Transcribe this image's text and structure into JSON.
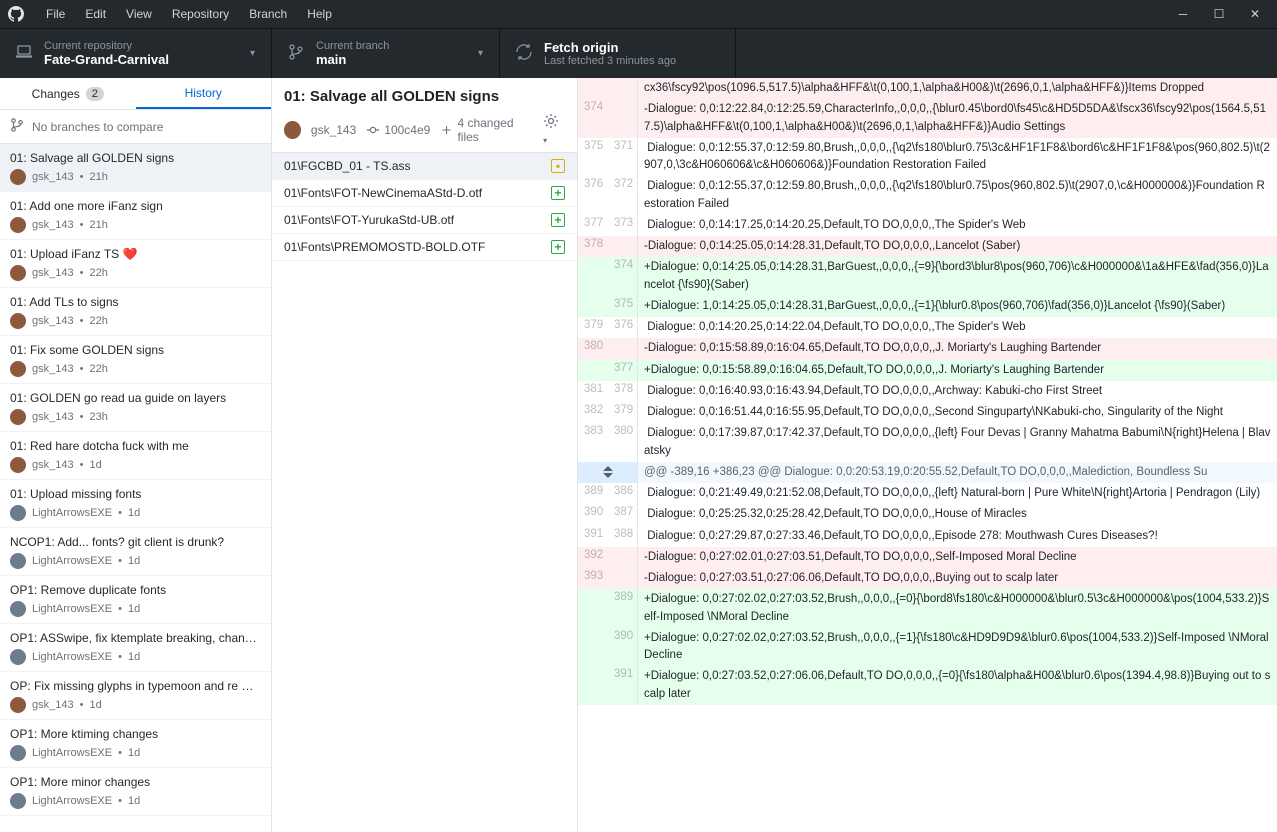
{
  "menus": [
    "File",
    "Edit",
    "View",
    "Repository",
    "Branch",
    "Help"
  ],
  "repo": {
    "label": "Current repository",
    "value": "Fate-Grand-Carnival"
  },
  "branch": {
    "label": "Current branch",
    "value": "main"
  },
  "fetch": {
    "label": "Fetch origin",
    "value": "Last fetched 3 minutes ago"
  },
  "tabs": {
    "changes": "Changes",
    "changes_count": "2",
    "history": "History"
  },
  "compare_text": "No branches to compare",
  "commits": [
    {
      "title": "01: Salvage all GOLDEN signs",
      "author": "gsk_143",
      "time": "21h",
      "avatar": "a",
      "selected": true
    },
    {
      "title": "01: Add one more iFanz sign",
      "author": "gsk_143",
      "time": "21h",
      "avatar": "a"
    },
    {
      "title": "01: Upload iFanz TS ❤️",
      "author": "gsk_143",
      "time": "22h",
      "avatar": "a"
    },
    {
      "title": "01: Add TLs to signs",
      "author": "gsk_143",
      "time": "22h",
      "avatar": "a"
    },
    {
      "title": "01: Fix some GOLDEN signs",
      "author": "gsk_143",
      "time": "22h",
      "avatar": "a"
    },
    {
      "title": "01: GOLDEN go read ua guide on layers",
      "author": "gsk_143",
      "time": "23h",
      "avatar": "a"
    },
    {
      "title": "01: Red hare dotcha fuck with me",
      "author": "gsk_143",
      "time": "1d",
      "avatar": "a"
    },
    {
      "title": "01: Upload missing fonts",
      "author": "LightArrowsEXE",
      "time": "1d",
      "avatar": "b"
    },
    {
      "title": "NCOP1: Add... fonts? git client is drunk?",
      "author": "LightArrowsEXE",
      "time": "1d",
      "avatar": "b"
    },
    {
      "title": "OP1: Remove duplicate fonts",
      "author": "LightArrowsEXE",
      "time": "1d",
      "avatar": "b"
    },
    {
      "title": "OP1: ASSwipe, fix ktemplate breaking, chan…",
      "author": "LightArrowsEXE",
      "time": "1d",
      "avatar": "b"
    },
    {
      "title": "OP: Fix missing glyphs in typemoon and re …",
      "author": "gsk_143",
      "time": "1d",
      "avatar": "a"
    },
    {
      "title": "OP1: More ktiming changes",
      "author": "LightArrowsEXE",
      "time": "1d",
      "avatar": "b"
    },
    {
      "title": "OP1: More minor changes",
      "author": "LightArrowsEXE",
      "time": "1d",
      "avatar": "b"
    }
  ],
  "commit_detail": {
    "title": "01: Salvage all GOLDEN signs",
    "author": "gsk_143",
    "sha": "100c4e9",
    "files_changed": "4 changed files"
  },
  "files": [
    {
      "name": "01\\FGCBD_01 - TS.ass",
      "status": "modified",
      "selected": true
    },
    {
      "name": "01\\Fonts\\FOT-NewCinemaAStd-D.otf",
      "status": "added"
    },
    {
      "name": "01\\Fonts\\FOT-YurukaStd-UB.otf",
      "status": "added"
    },
    {
      "name": "01\\Fonts\\PREMOMOSTD-BOLD.OTF",
      "status": "added"
    }
  ],
  "diff": [
    {
      "type": "del",
      "old": "",
      "new": "",
      "code": "cx36\\fscy92\\pos(1096.5,517.5)\\alpha&HFF&\\t(0,100,1,\\alpha&H00&)\\t(2696,0,1,\\alpha&HFF&)}Items Dropped"
    },
    {
      "type": "del",
      "old": "374",
      "new": "",
      "code": "-Dialogue: 0,0:12:22.84,0:12:25.59,CharacterInfo,,0,0,0,,{\\blur0.45\\bord0\\fs45\\c&HD5D5DA&\\fscx36\\fscy92\\pos(1564.5,517.5)\\alpha&HFF&\\t(0,100,1,\\alpha&H00&)\\t(2696,0,1,\\alpha&HFF&)}Audio Settings"
    },
    {
      "type": "ctx",
      "old": "375",
      "new": "371",
      "code": " Dialogue: 0,0:12:55.37,0:12:59.80,Brush,,0,0,0,,{\\q2\\fs180\\blur0.75\\3c&HF1F1F8&\\bord6\\c&HF1F1F8&\\pos(960,802.5)\\t(2907,0,\\3c&H060606&\\c&H060606&)}Foundation Restoration Failed"
    },
    {
      "type": "ctx",
      "old": "376",
      "new": "372",
      "code": " Dialogue: 0,0:12:55.37,0:12:59.80,Brush,,0,0,0,,{\\q2\\fs180\\blur0.75\\pos(960,802.5)\\t(2907,0,\\c&H000000&)}Foundation Restoration Failed"
    },
    {
      "type": "ctx",
      "old": "377",
      "new": "373",
      "code": " Dialogue: 0,0:14:17.25,0:14:20.25,Default,TO DO,0,0,0,,The Spider's Web"
    },
    {
      "type": "del",
      "old": "378",
      "new": "",
      "code": "-Dialogue: 0,0:14:25.05,0:14:28.31,Default,TO DO,0,0,0,,Lancelot (Saber)"
    },
    {
      "type": "add",
      "old": "",
      "new": "374",
      "code": "+Dialogue: 0,0:14:25.05,0:14:28.31,BarGuest,,0,0,0,,{=9}{\\bord3\\blur8\\pos(960,706)\\c&H000000&\\1a&HFE&\\fad(356,0)}Lancelot {\\fs90}(Saber)"
    },
    {
      "type": "add",
      "old": "",
      "new": "375",
      "code": "+Dialogue: 1,0:14:25.05,0:14:28.31,BarGuest,,0,0,0,,{=1}{\\blur0.8\\pos(960,706)\\fad(356,0)}Lancelot {\\fs90}(Saber)"
    },
    {
      "type": "ctx",
      "old": "379",
      "new": "376",
      "code": " Dialogue: 0,0:14:20.25,0:14:22.04,Default,TO DO,0,0,0,,The Spider's Web"
    },
    {
      "type": "del",
      "old": "380",
      "new": "",
      "code": "-Dialogue: 0,0:15:58.89,0:16:04.65,Default,TO DO,0,0,0,,J. Moriarty's Laughing Bartender"
    },
    {
      "type": "add",
      "old": "",
      "new": "377",
      "code": "+Dialogue: 0,0:15:58.89,0:16:04.65,Default,TO DO,0,0,0,,J. Moriarty's Laughing Bartender"
    },
    {
      "type": "ctx",
      "old": "381",
      "new": "378",
      "code": " Dialogue: 0,0:16:40.93,0:16:43.94,Default,TO DO,0,0,0,,Archway: Kabuki-cho First Street"
    },
    {
      "type": "ctx",
      "old": "382",
      "new": "379",
      "code": " Dialogue: 0,0:16:51.44,0:16:55.95,Default,TO DO,0,0,0,,Second Singuparty\\NKabuki-cho, Singularity of the Night"
    },
    {
      "type": "ctx",
      "old": "383",
      "new": "380",
      "code": " Dialogue: 0,0:17:39.87,0:17:42.37,Default,TO DO,0,0,0,,{left} Four Devas | Granny Mahatma Babumi\\N{right}Helena | Blavatsky"
    },
    {
      "type": "hunk",
      "code": "@@ -389,16 +386,23 @@ Dialogue: 0,0:20:53.19,0:20:55.52,Default,TO DO,0,0,0,,Malediction, Boundless Su"
    },
    {
      "type": "ctx",
      "old": "389",
      "new": "386",
      "code": " Dialogue: 0,0:21:49.49,0:21:52.08,Default,TO DO,0,0,0,,{left} Natural-born | Pure White\\N{right}Artoria | Pendragon (Lily)"
    },
    {
      "type": "ctx",
      "old": "390",
      "new": "387",
      "code": " Dialogue: 0,0:25:25.32,0:25:28.42,Default,TO DO,0,0,0,,House of Miracles"
    },
    {
      "type": "ctx",
      "old": "391",
      "new": "388",
      "code": " Dialogue: 0,0:27:29.87,0:27:33.46,Default,TO DO,0,0,0,,Episode 278: Mouthwash Cures Diseases?!"
    },
    {
      "type": "del",
      "old": "392",
      "new": "",
      "code": "-Dialogue: 0,0:27:02.01,0:27:03.51,Default,TO DO,0,0,0,,Self-Imposed Moral Decline"
    },
    {
      "type": "del",
      "old": "393",
      "new": "",
      "code": "-Dialogue: 0,0:27:03.51,0:27:06.06,Default,TO DO,0,0,0,,Buying out to scalp later"
    },
    {
      "type": "add",
      "old": "",
      "new": "389",
      "code": "+Dialogue: 0,0:27:02.02,0:27:03.52,Brush,,0,0,0,,{=0}{\\bord8\\fs180\\c&H000000&\\blur0.5\\3c&H000000&\\pos(1004,533.2)}Self-Imposed \\NMoral Decline"
    },
    {
      "type": "add",
      "old": "",
      "new": "390",
      "code": "+Dialogue: 0,0:27:02.02,0:27:03.52,Brush,,0,0,0,,{=1}{\\fs180\\c&HD9D9D9&\\blur0.6\\pos(1004,533.2)}Self-Imposed \\NMoral Decline"
    },
    {
      "type": "add",
      "old": "",
      "new": "391",
      "code": "+Dialogue: 0,0:27:03.52,0:27:06.06,Default,TO DO,0,0,0,,{=0}{\\fs180\\alpha&H00&\\blur0.6\\pos(1394.4,98.8)}Buying out to scalp later"
    }
  ]
}
